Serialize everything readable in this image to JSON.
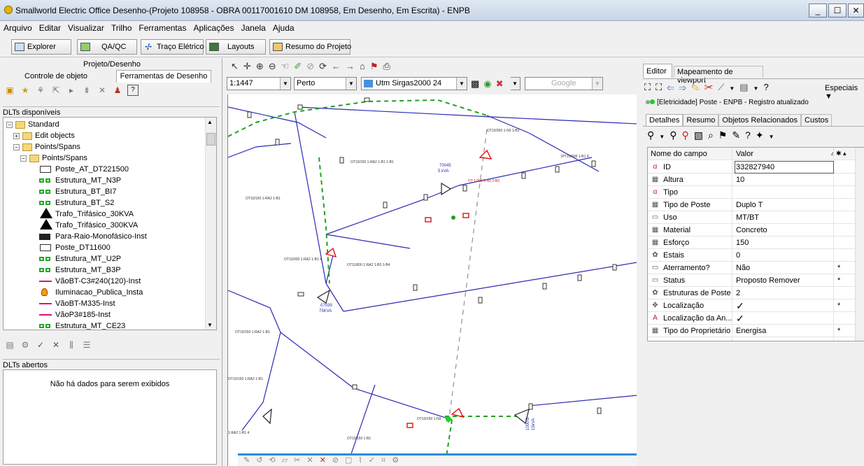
{
  "window": {
    "title": "Smallworld Electric Office Desenho-(Projeto 108958 - OBRA 00117001610 DM 108958, Em Desenho, Em Escrita) - ENPB"
  },
  "menu": [
    "Arquivo",
    "Editar",
    "Visualizar",
    "Trilho",
    "Ferramentas",
    "Aplicações",
    "Janela",
    "Ajuda"
  ],
  "toolbar": {
    "explorer": "Explorer",
    "qaqc": "QA/QC",
    "traco": "Traço Elétrico",
    "layouts": "Layouts",
    "resumo": "Resumo do Projeto"
  },
  "left": {
    "header": "Projeto/Desenho",
    "tab_controle": "Controle de objeto",
    "tab_ferramentas": "Ferramentas de Desenho",
    "dlts_disponiveis": "DLTs disponíveis",
    "tree": [
      {
        "label": "Standard",
        "kind": "folder",
        "pm": "−"
      },
      {
        "label": "Edit objects",
        "kind": "folder",
        "pm": "+"
      },
      {
        "label": "Points/Spans",
        "kind": "folder",
        "pm": "−"
      },
      {
        "label": "Points/Spans",
        "kind": "folder",
        "pm": "−"
      },
      {
        "label": "Poste_AT_DT221500",
        "kind": "rect"
      },
      {
        "label": "Estrutura_MT_N3P",
        "kind": "green"
      },
      {
        "label": "Estrutura_BT_BI7",
        "kind": "green"
      },
      {
        "label": "Estrutura_BT_S2",
        "kind": "green"
      },
      {
        "label": "Trafo_Trifásico_30KVA",
        "kind": "tri"
      },
      {
        "label": "Trafo_Trifásico_300KVA",
        "kind": "tri"
      },
      {
        "label": "Para-Raio-Monofásico-Inst",
        "kind": "black"
      },
      {
        "label": "Poste_DT11600",
        "kind": "rect"
      },
      {
        "label": "Estrutura_MT_U2P",
        "kind": "green"
      },
      {
        "label": "Estrutura_MT_B3P",
        "kind": "green"
      },
      {
        "label": "VãoBT-C3#240(120)-Inst",
        "kind": "line"
      },
      {
        "label": "Iluminacao_Publica_Insta",
        "kind": "lamp"
      },
      {
        "label": "VãoBT-M335-Inst",
        "kind": "line"
      },
      {
        "label": "VãoP3#185-Inst",
        "kind": "line"
      },
      {
        "label": "Estrutura_MT_CE23",
        "kind": "green"
      }
    ],
    "dlts_abertos": "DLTs abertos",
    "no_data": "Não há dados para serem exibidos"
  },
  "map": {
    "scale": "1:1447",
    "zoom": "Perto",
    "projection": "Utm Sirgas2000 24",
    "basemap": "Google",
    "labels": {
      "t1": "70045",
      "t2": "5 kVA",
      "t3": "07039",
      "t4": "75KVA",
      "t5": "1000\\5",
      "t6": "15kVA"
    }
  },
  "right": {
    "tab_editor": "Editor",
    "tab_map": "Mapeamento de viewport",
    "especiais": "Especiais",
    "record": "[Eletricidade] Poste - ENPB    - Registro atualizado",
    "subtabs": [
      "Detalhes",
      "Resumo",
      "Objetos Relacionados",
      "Custos"
    ],
    "col_field": "Nome do campo",
    "col_value": "Valor",
    "rows": [
      {
        "field": "ID",
        "value": "332827940",
        "icon": "α",
        "req": ""
      },
      {
        "field": "Altura",
        "value": "10",
        "icon": "▦",
        "req": ""
      },
      {
        "field": "Tipo",
        "value": "",
        "icon": "α",
        "req": ""
      },
      {
        "field": "Tipo de Poste",
        "value": "Duplo T",
        "icon": "▦",
        "req": ""
      },
      {
        "field": "Uso",
        "value": "MT/BT",
        "icon": "▭",
        "req": ""
      },
      {
        "field": "Material",
        "value": "Concreto",
        "icon": "▦",
        "req": ""
      },
      {
        "field": "Esforço",
        "value": "150",
        "icon": "▦",
        "req": ""
      },
      {
        "field": "Estais",
        "value": "0",
        "icon": "✿",
        "req": ""
      },
      {
        "field": "Aterramento?",
        "value": "Não",
        "icon": "▭",
        "req": "*"
      },
      {
        "field": "Status",
        "value": "Proposto Remover",
        "icon": "▭",
        "req": "*"
      },
      {
        "field": "Estruturas de Poste",
        "value": "2",
        "icon": "✿",
        "req": ""
      },
      {
        "field": "Localização",
        "value": "✓",
        "icon": "✥",
        "req": "*"
      },
      {
        "field": "Localização da An...",
        "value": "✓",
        "icon": "A",
        "req": ""
      },
      {
        "field": "Tipo do Proprietário",
        "value": "Energisa",
        "icon": "▦",
        "req": "*"
      }
    ]
  }
}
